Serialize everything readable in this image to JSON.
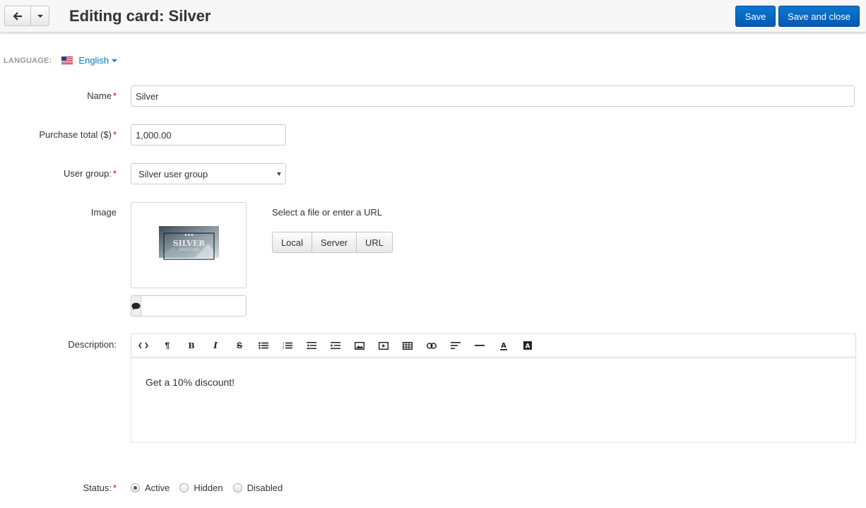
{
  "header": {
    "title": "Editing card: Silver",
    "save_label": "Save",
    "save_close_label": "Save and close"
  },
  "language": {
    "label": "LANGUAGE:",
    "current": "English"
  },
  "form": {
    "name": {
      "label": "Name",
      "value": "Silver"
    },
    "purchase_total": {
      "label": "Purchase total ($)",
      "value": "1,000.00"
    },
    "user_group": {
      "label": "User group:",
      "value": "Silver user group"
    },
    "image": {
      "label": "Image",
      "hint": "Select a file or enter a URL",
      "sources": [
        "Local",
        "Server",
        "URL"
      ],
      "alt_value": "",
      "thumb_title": "SILVER",
      "thumb_subtitle": "LOYALTY CARD"
    },
    "description": {
      "label": "Description:",
      "content": "Get a 10% discount!",
      "toolbar": [
        "html",
        "paragraph",
        "bold",
        "italic",
        "strikethrough",
        "unordered-list",
        "ordered-list",
        "outdent",
        "indent",
        "image",
        "video",
        "table",
        "link",
        "alignment",
        "horizontal-rule",
        "font-color",
        "background-color"
      ]
    },
    "status": {
      "label": "Status:",
      "options": [
        "Active",
        "Hidden",
        "Disabled"
      ],
      "selected": "Active"
    }
  },
  "colors": {
    "primary": "#0a6cc9",
    "link": "#0b7bc4",
    "required": "#d0021b"
  }
}
